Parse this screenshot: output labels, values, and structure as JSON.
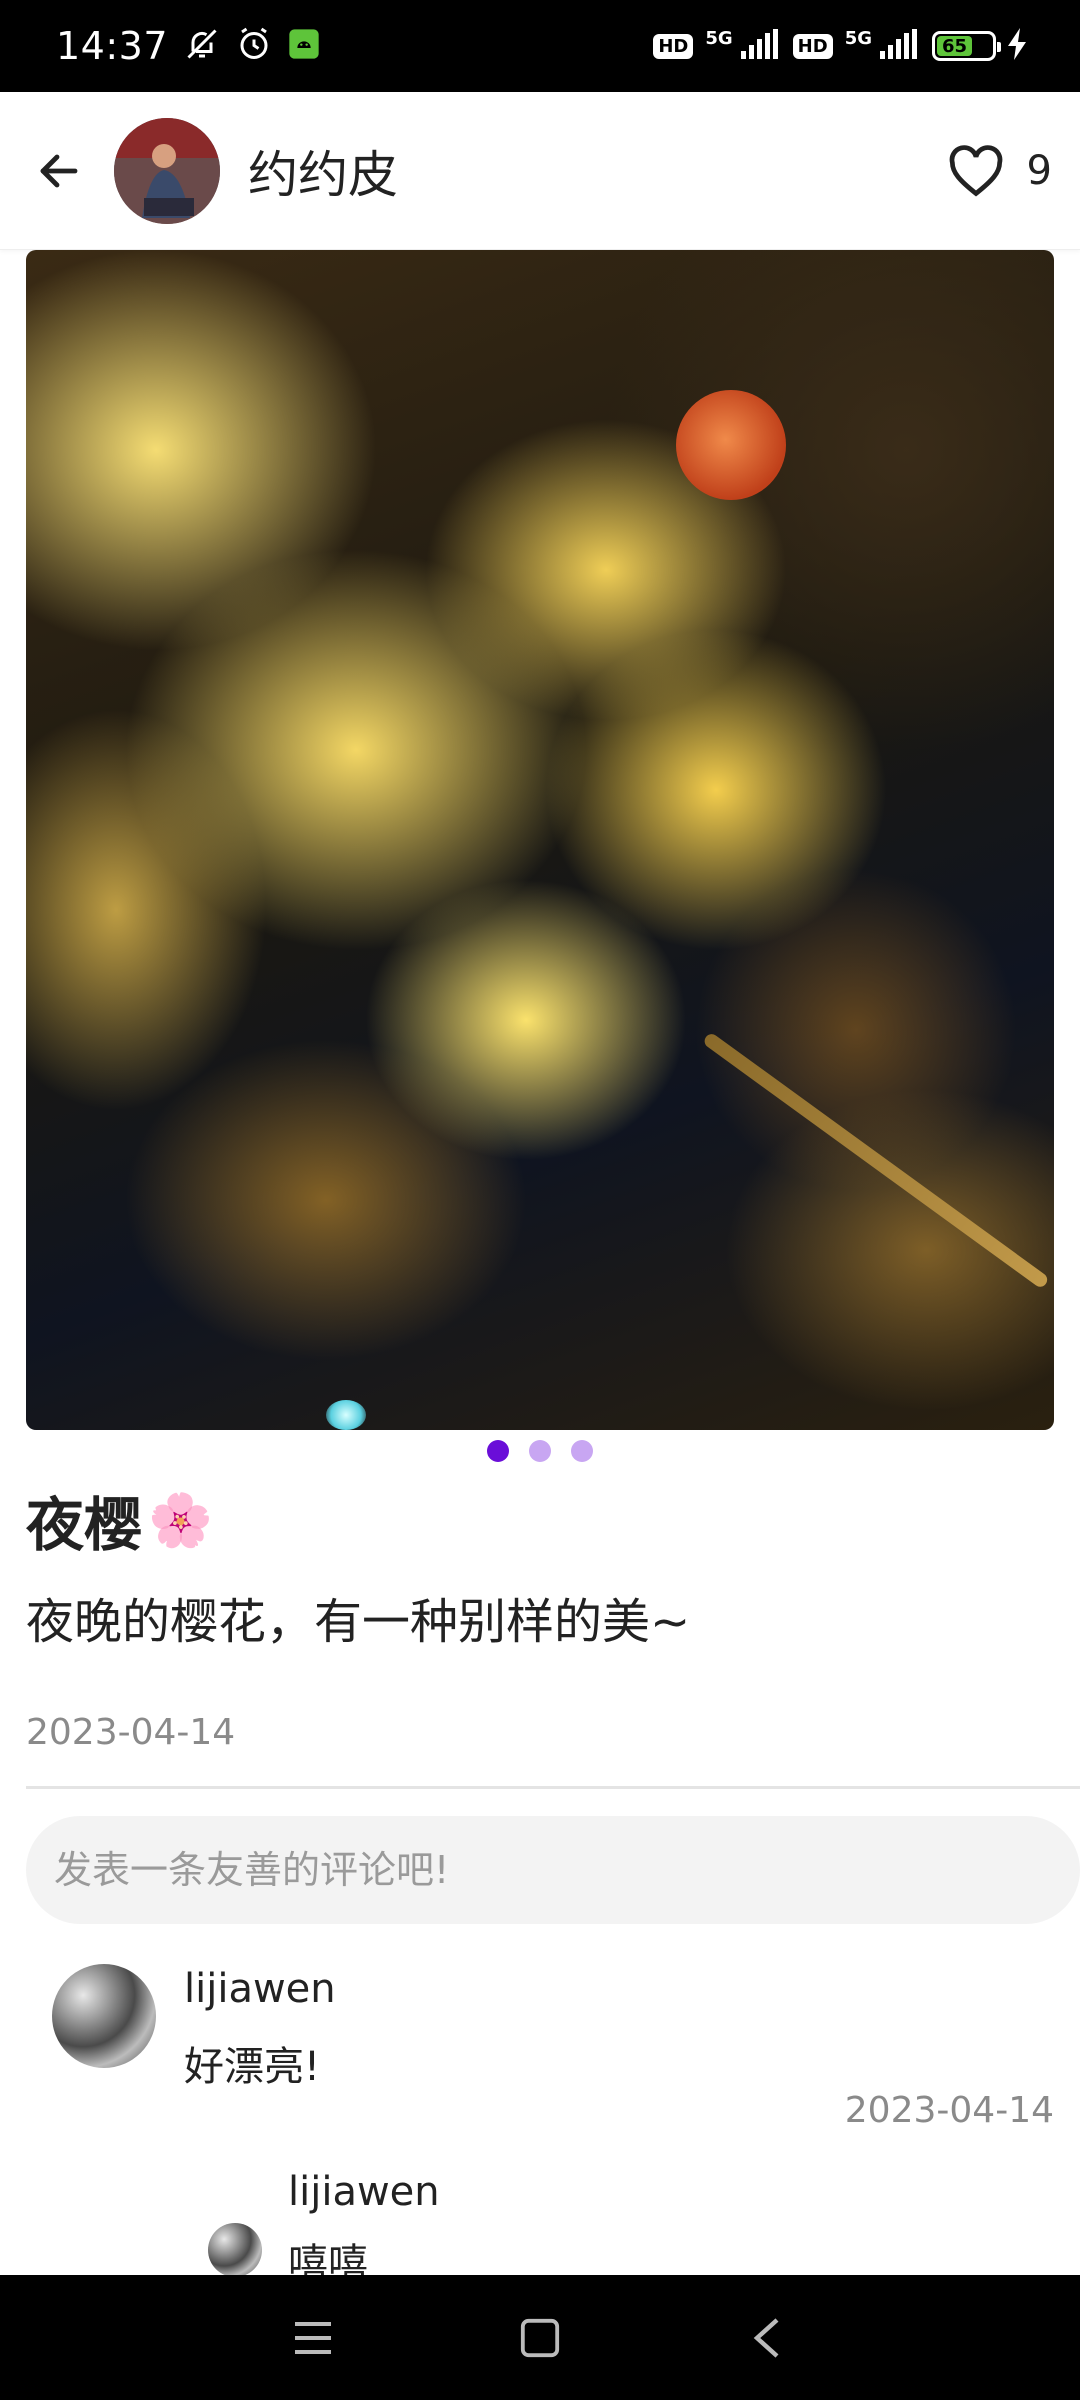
{
  "status_bar": {
    "time": "14:37",
    "network_1": "5G",
    "network_2": "5G",
    "hd_1": "HD",
    "hd_2": "HD",
    "battery_level": "65",
    "battery_fraction": 0.65,
    "icons": [
      "bell-off-icon",
      "alarm-icon",
      "android-notification-icon",
      "hd-icon",
      "signal-icon",
      "battery-icon",
      "charging-icon"
    ]
  },
  "header": {
    "author_name": "约约皮",
    "like_count": "9",
    "icons": [
      "back-arrow-icon",
      "heart-outline-icon"
    ]
  },
  "carousel": {
    "dot_count": 3,
    "active_index": 0
  },
  "post": {
    "title": "夜樱",
    "title_emoji": "🌸",
    "body": "夜晚的樱花，有一种别样的美~",
    "date": "2023-04-14"
  },
  "comment_box": {
    "placeholder": "发表一条友善的评论吧!"
  },
  "comments": [
    {
      "user": "lijiawen",
      "text": "好漂亮!",
      "date": "2023-04-14"
    },
    {
      "user": "lijiawen",
      "text": "嘻嘻"
    }
  ],
  "colors": {
    "accent": "#6a0ed8",
    "dot_inactive": "#c8a6f2",
    "muted_text": "#8a8a8a",
    "battery_green": "#5ec43a"
  }
}
